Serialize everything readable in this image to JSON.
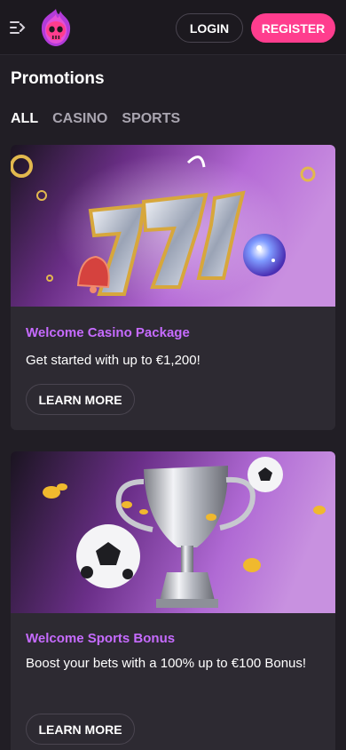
{
  "header": {
    "login_label": "LOGIN",
    "register_label": "REGISTER",
    "icons": {
      "menu": "menu-arrow-icon",
      "logo": "flaming-skull-logo"
    }
  },
  "page_title": "Promotions",
  "tabs": [
    {
      "label": "ALL",
      "active": true
    },
    {
      "label": "CASINO",
      "active": false
    },
    {
      "label": "SPORTS",
      "active": false
    }
  ],
  "promotions": [
    {
      "title": "Welcome Casino Package",
      "description": "Get started with up to €1,200!",
      "button_label": "LEARN MORE",
      "image": "slot-777-chrome-bell-image"
    },
    {
      "title": "Welcome Sports Bonus",
      "description": "Boost your bets with a 100% up to €100 Bonus!",
      "button_label": "LEARN MORE",
      "image": "trophy-soccer-balls-image"
    }
  ],
  "colors": {
    "background": "#211e25",
    "header": "#1c191f",
    "card": "#2d2a32",
    "accent": "#ff3d8e",
    "promo_title": "#c66bff",
    "tab_inactive": "#a9a5b0"
  }
}
